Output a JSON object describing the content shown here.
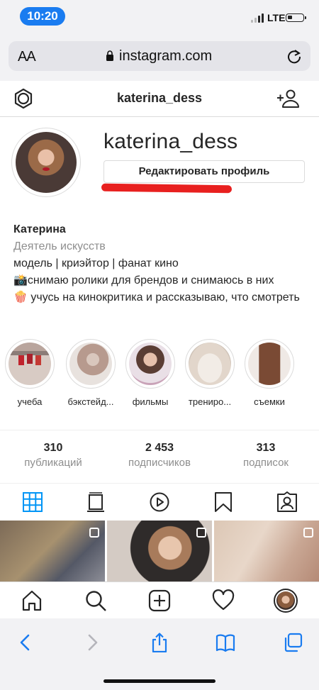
{
  "status_bar": {
    "time": "10:20",
    "network": "LTE"
  },
  "browser": {
    "text_size_label": "AA",
    "url": "instagram.com"
  },
  "header": {
    "username": "katerina_dess"
  },
  "profile": {
    "username": "katerina_dess",
    "edit_button_label": "Редактировать профиль",
    "name": "Катерина",
    "category": "Деятель искусств",
    "bio_lines": [
      "модель | криэйтор | фанат кино",
      "📸снимаю ролики для брендов и снимаюсь в них",
      "🍿 учусь на кинокритика и рассказываю, что смотреть"
    ]
  },
  "highlights": [
    {
      "label": "учеба"
    },
    {
      "label": "бэкстейд..."
    },
    {
      "label": "фильмы"
    },
    {
      "label": "трениро..."
    },
    {
      "label": "съемки"
    }
  ],
  "stats": [
    {
      "value": "310",
      "label": "публикаций"
    },
    {
      "value": "2 453",
      "label": "подписчиков"
    },
    {
      "value": "313",
      "label": "подписок"
    }
  ],
  "tabs": [
    "grid-icon",
    "igtv-icon",
    "reels-play-icon",
    "saved-bookmark-icon",
    "tagged-icon"
  ],
  "active_tab": "grid-icon",
  "colors": {
    "accent": "#0095f6",
    "time_pill": "#1a7cf0",
    "highlight_mark": "#e8201f"
  }
}
